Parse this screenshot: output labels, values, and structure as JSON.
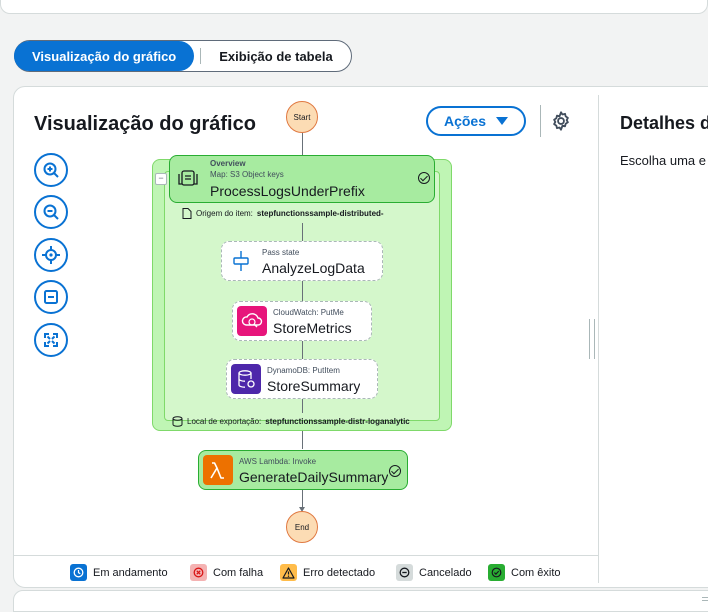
{
  "view_toggle": {
    "graph_label": "Visualização do gráfico",
    "table_label": "Exibição de tabela"
  },
  "graph_panel": {
    "title": "Visualização do gráfico",
    "actions_label": "Ações"
  },
  "details_panel": {
    "title": "Detalhes d",
    "text": "Escolha uma e"
  },
  "graph": {
    "start_label": "Start",
    "end_label": "End",
    "map": {
      "tag": "Overview",
      "type": "Map: S3 Object keys",
      "name": "ProcessLogsUnderPrefix",
      "item_source_label": "Origem do item:",
      "item_source_value": "stepfunctionssample-distributed-",
      "export_label": "Local de exportação:",
      "export_value": "stepfunctionssample-distr-loganalytic"
    },
    "pass": {
      "type": "Pass state",
      "name": "AnalyzeLogData"
    },
    "metrics": {
      "type": "CloudWatch: PutMe",
      "name": "StoreMetrics"
    },
    "summary": {
      "type": "DynamoDB: PutItem",
      "name": "StoreSummary"
    },
    "lambda": {
      "type": "AWS Lambda: Invoke",
      "name": "GenerateDailySummary"
    }
  },
  "legend": [
    {
      "label": "Em andamento",
      "color": "#0972d3"
    },
    {
      "label": "Com falha",
      "color": "#d91515"
    },
    {
      "label": "Erro detectado",
      "color": "#f89256"
    },
    {
      "label": "Cancelado",
      "color": "#aab7b8"
    },
    {
      "label": "Com êxito",
      "color": "#29ad32"
    }
  ],
  "icons": [
    "zoom-in-icon",
    "zoom-out-icon",
    "center-icon",
    "fit-icon",
    "fullscreen-icon",
    "gear-icon",
    "caret-down-icon"
  ]
}
